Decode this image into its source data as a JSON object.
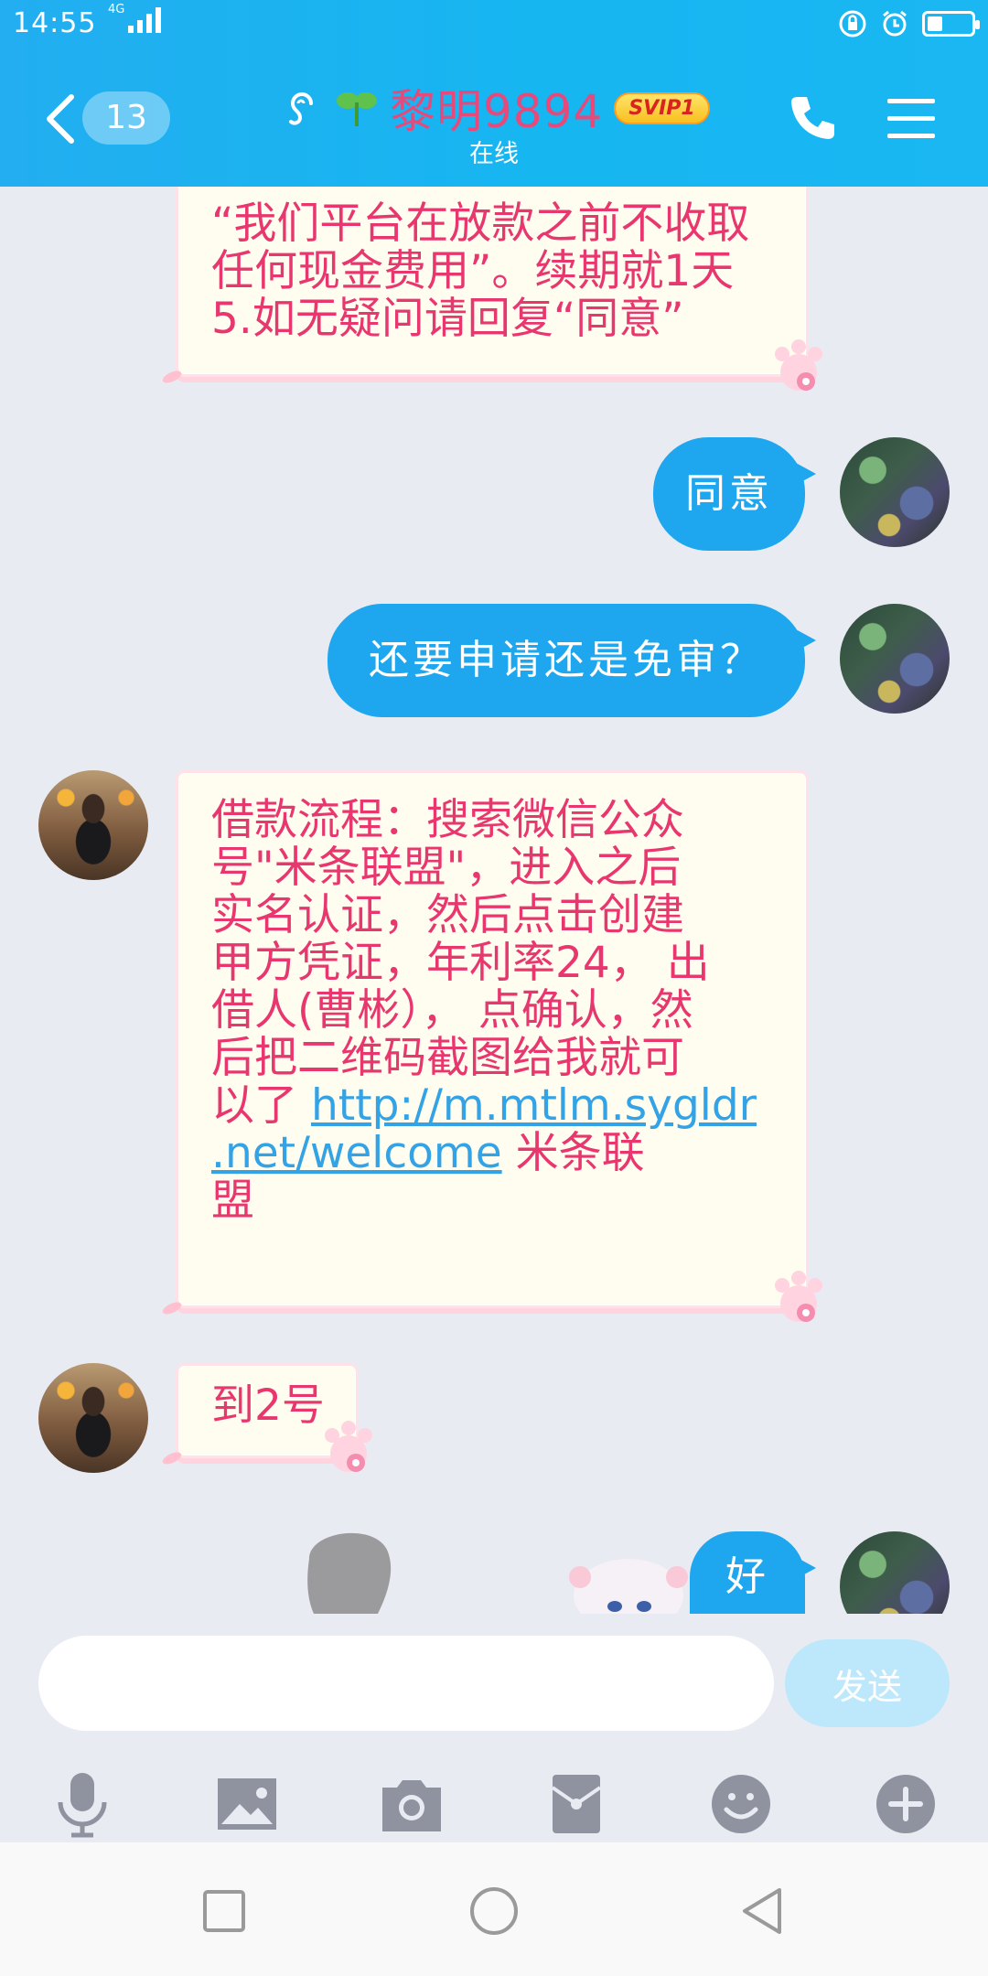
{
  "status_bar": {
    "time": "14:55",
    "network": "4G"
  },
  "header": {
    "unread_count": "13",
    "contact_name": "黎明9894",
    "vip_badge": "SVIP1",
    "status": "在线"
  },
  "messages": [
    {
      "side": "left",
      "text_lines": [
        "“我们平台在放款之前不收取",
        "任何现金费用”。续期就1天",
        "5.如无疑问请回复“同意”"
      ]
    },
    {
      "side": "right",
      "text": "同意"
    },
    {
      "side": "right",
      "text": "还要申请还是免审？"
    },
    {
      "side": "left",
      "text_lines": [
        "借款流程：搜索微信公众",
        "号\"米条联盟\"，进入之后",
        "实名认证，然后点击创建",
        "甲方凭证，年利率24， 出",
        "借人(曹彬）， 点确认，然",
        "后把二维码截图给我就可"
      ],
      "last_line_prefix": "以了 ",
      "link_part1": "http://m.mtlm.sygldr",
      "link_part2": ".net/welcome",
      "after_link": " 米条联",
      "final_line": "盟"
    },
    {
      "side": "left",
      "text": "到2号"
    },
    {
      "side": "right",
      "text": "好"
    }
  ],
  "input": {
    "placeholder": "",
    "send_label": "发送"
  },
  "toolbar": {
    "items": [
      "microphone-icon",
      "image-icon",
      "camera-icon",
      "red-packet-icon",
      "emoji-icon",
      "plus-icon"
    ]
  },
  "colors": {
    "header": "#1ab7f2",
    "bubble_blue": "#1ea7ee",
    "pink_text": "#e8376f",
    "link": "#33a3e6"
  }
}
